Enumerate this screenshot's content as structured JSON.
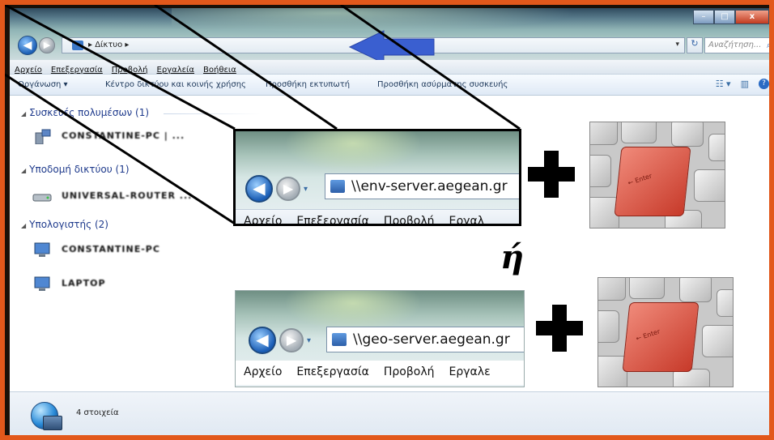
{
  "window": {
    "controls": {
      "minimize": "–",
      "maximize": "□",
      "close": "x"
    }
  },
  "address_bar": {
    "back_icon": "back-arrow-icon",
    "forward_icon": "forward-arrow-icon",
    "breadcrumb": "▸ Δίκτυο ▸",
    "dropdown": "▾",
    "refresh": "↻",
    "search_placeholder": "Αναζήτηση...",
    "search_icon": "magnifier-icon"
  },
  "annotation_arrow_color": "#3a5fd0",
  "menu": {
    "items": [
      "Αρχείο",
      "Επεξεργασία",
      "Προβολή",
      "Εργαλεία",
      "Βοήθεια"
    ]
  },
  "toolbar": {
    "organize": "Οργάνωση ▾",
    "network_center": "Κέντρο δικτύου και κοινής χρήσης",
    "add_printer": "Προσθήκη εκτυπωτή",
    "add_wireless": "Προσθήκη ασύρματης συσκευής",
    "view_icons": [
      "view-options-icon",
      "preview-pane-icon",
      "help-icon"
    ]
  },
  "groups": [
    {
      "title": "Συσκευές πολυμέσων (1)",
      "items": [
        {
          "label": "CONSTANTINE-PC | ...",
          "icon": "media-device-icon"
        }
      ]
    },
    {
      "title": "Υποδομή δικτύου (1)",
      "items": [
        {
          "label": "UNIVERSAL-ROUTER ...",
          "icon": "router-icon"
        }
      ]
    },
    {
      "title": "Υπολογιστής (2)",
      "items": [
        {
          "label": "CONSTANTINE-PC",
          "icon": "computer-icon"
        },
        {
          "label": "LAPTOP",
          "icon": "computer-icon"
        }
      ]
    }
  ],
  "status": {
    "count": "4 στοιχεία",
    "icon": "network-globe-icon"
  },
  "zoom_callouts": [
    {
      "address": "\\\\env-server.aegean.gr",
      "menu": [
        "Αρχείο",
        "Επεξεργασία",
        "Προβολή",
        "Εργαλ"
      ]
    },
    {
      "address": "\\\\geo-server.aegean.gr",
      "menu": [
        "Αρχείο",
        "Επεξεργασία",
        "Προβολή",
        "Εργαλε"
      ]
    }
  ],
  "or_text": "ή",
  "enter_key_label": "← Enter",
  "highlight_colors": {
    "enter_key": "#e0533f",
    "frame": "#e2581b"
  }
}
